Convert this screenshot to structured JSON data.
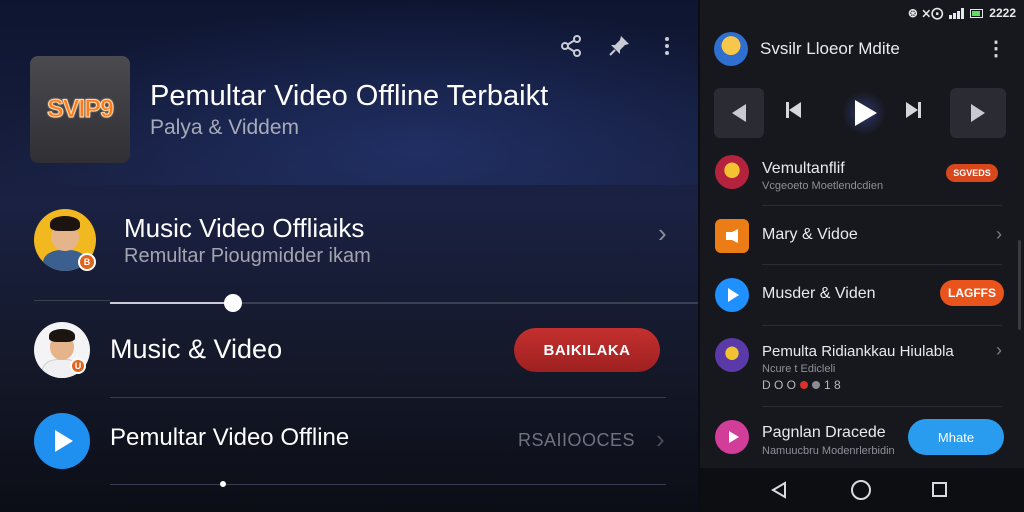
{
  "left_panel": {
    "app_icon_label": "SVIP9",
    "title": "Pemultar Video Offline Terbaikt",
    "subtitle": "Palya & Viddem",
    "actions": {
      "share_icon": "share-icon",
      "pin_icon": "pin-icon",
      "more_icon": "more-vertical-icon"
    },
    "rows": [
      {
        "title": "Music Video Offliaiks",
        "subtitle": "Remultar Piougmidder ikam",
        "badge": "B"
      },
      {
        "title": "Music & Video",
        "button_label": "BAIKILAKA",
        "badge": "U"
      },
      {
        "title": "Pemultar Video Offline",
        "status_text": "RSAIIOOCES"
      }
    ],
    "slider_progress": 0.21
  },
  "right_panel": {
    "status_bar": {
      "icons": "⊛ ⨯⨀",
      "time": "2222"
    },
    "header_title": "Svsilr Lloeor Mdite",
    "menu_icon": "more-vertical-icon",
    "items": [
      {
        "title": "Vemultanflif",
        "subtitle": "Vcgeoeto Moetlendcdien",
        "pill": "SGVEDS"
      },
      {
        "title": "Mary & Vidoe"
      },
      {
        "title": "Musder & Viden",
        "pill": "LAGFFS"
      },
      {
        "title": "Pemulta Ridiankkau Hiulabla",
        "subtitle": "Ncure t Edicleli",
        "meta": "D O O",
        "meta2": "1 8"
      },
      {
        "title": "Pagnlan Dracede",
        "subtitle": "Namuucbru Modenrlerbidin",
        "pill": "Mhate"
      }
    ]
  }
}
